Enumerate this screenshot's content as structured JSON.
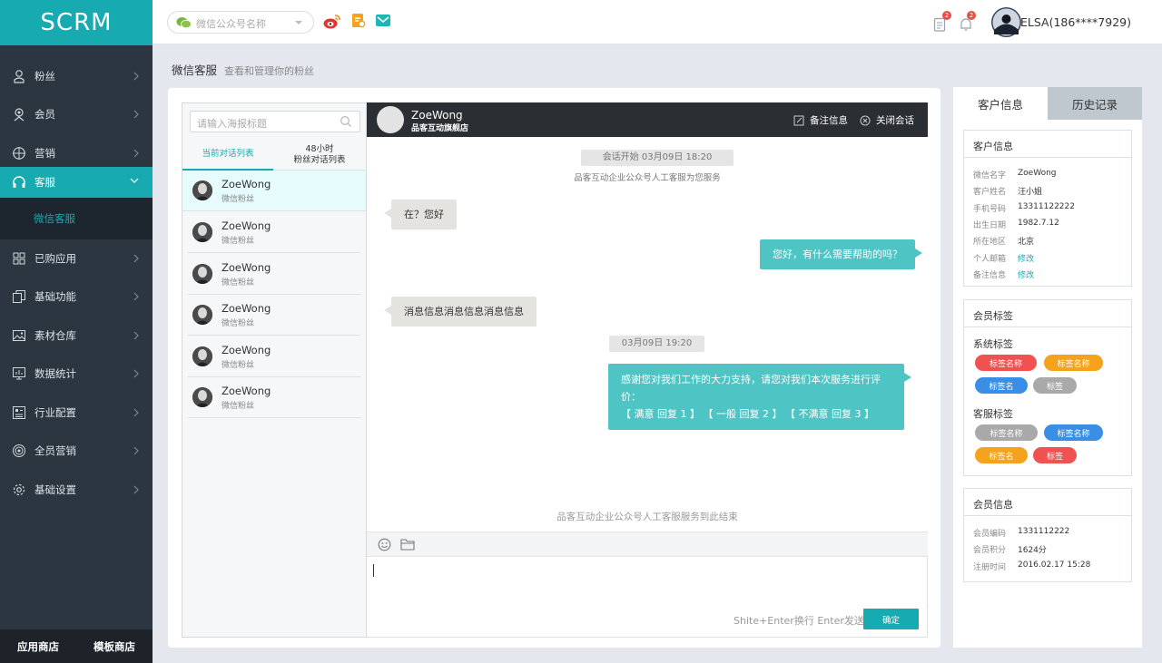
{
  "app": {
    "logo": "SCRM"
  },
  "sidebar": {
    "items": [
      {
        "label": "粉丝",
        "icon": "user-icon"
      },
      {
        "label": "会员",
        "icon": "member-icon"
      },
      {
        "label": "营销",
        "icon": "compass-icon"
      },
      {
        "label": "客服",
        "icon": "headset-icon"
      },
      {
        "label": "已购应用",
        "icon": "apps-grid-icon"
      },
      {
        "label": "基础功能",
        "icon": "copy-icon"
      },
      {
        "label": "素材仓库",
        "icon": "image-icon"
      },
      {
        "label": "数据统计",
        "icon": "chart-icon"
      },
      {
        "label": "行业配置",
        "icon": "config-icon"
      },
      {
        "label": "全员营销",
        "icon": "target-icon"
      },
      {
        "label": "基础设置",
        "icon": "gear-icon"
      }
    ],
    "sub_item": "微信客服",
    "footer": [
      "应用商店",
      "模板商店"
    ]
  },
  "header": {
    "account_placeholder": "微信公众号名称",
    "badge_clipboard": "2",
    "badge_bell": "2",
    "user": "ELSA(186****7929)"
  },
  "breadcrumb": {
    "title": "微信客服",
    "subtitle": "查看和管理你的粉丝"
  },
  "conversations": {
    "search_placeholder": "请输入海报标题",
    "tabs": [
      {
        "line1": "当前对话列表",
        "line2": ""
      },
      {
        "line1": "48小时",
        "line2": "粉丝对话列表"
      }
    ],
    "items": [
      {
        "name": "ZoeWong",
        "tag": "微信粉丝"
      },
      {
        "name": "ZoeWong",
        "tag": "微信粉丝"
      },
      {
        "name": "ZoeWong",
        "tag": "微信粉丝"
      },
      {
        "name": "ZoeWong",
        "tag": "微信粉丝"
      },
      {
        "name": "ZoeWong",
        "tag": "微信粉丝"
      },
      {
        "name": "ZoeWong",
        "tag": "微信粉丝"
      }
    ]
  },
  "chat": {
    "name": "ZoeWong",
    "shop": "品客互动旗舰店",
    "note_label": "备注信息",
    "close_label": "关闭会话",
    "start_time": "会话开始 03月09日 18:20",
    "welcome": "品客互动企业公众号人工客服为您服务",
    "messages": [
      {
        "side": "left",
        "text": "在？您好"
      },
      {
        "side": "right",
        "text": "您好，有什么需要帮助的吗？"
      },
      {
        "side": "left",
        "text": "消息信息消息信息消息信息"
      }
    ],
    "time2": "03月09日 19:20",
    "survey_line1": "感谢您对我们工作的大力支持，请您对我们本次服务进行评价：",
    "survey_line2": "【 满意 回复 1 】 【 一般 回复 2 】 【 不满意 回复 3 】",
    "end_text": "品客互动企业公众号人工客服服务到此结束",
    "hint": "Shite+Enter换行 Enter发送",
    "send": "确定"
  },
  "customer": {
    "tabs": [
      "客户信息",
      "历史记录"
    ],
    "info_title": "客户信息",
    "info": [
      {
        "k": "微信名字",
        "v": "ZoeWong"
      },
      {
        "k": "客户姓名",
        "v": "汪小姐"
      },
      {
        "k": "手机号码",
        "v": "13311122222"
      },
      {
        "k": "出生日期",
        "v": "1982.7.12"
      },
      {
        "k": "所在地区",
        "v": "北京"
      },
      {
        "k": "个人邮箱",
        "v": "修改"
      },
      {
        "k": "备注信息",
        "v": "修改"
      }
    ],
    "tags_title": "会员标签",
    "system_tags_label": "系统标签",
    "system_tags": [
      "标签名称",
      "标签名称",
      "标签名",
      "标签"
    ],
    "service_tags_label": "客服标签",
    "service_tags": [
      "标签名称",
      "标签名称",
      "标签名",
      "标签"
    ],
    "member_title": "会员信息",
    "member": [
      {
        "k": "会员编码",
        "v": "1331112222"
      },
      {
        "k": "会员积分",
        "v": "1624分"
      },
      {
        "k": "注册时间",
        "v": "2016.02.17 15:28"
      }
    ]
  },
  "colors": {
    "accent": "#17aab0",
    "sidebar": "#2c3640",
    "red": "#f05252",
    "orange": "#f5a21c",
    "blue": "#3a8ee6",
    "gray": "#a9a9a9"
  }
}
